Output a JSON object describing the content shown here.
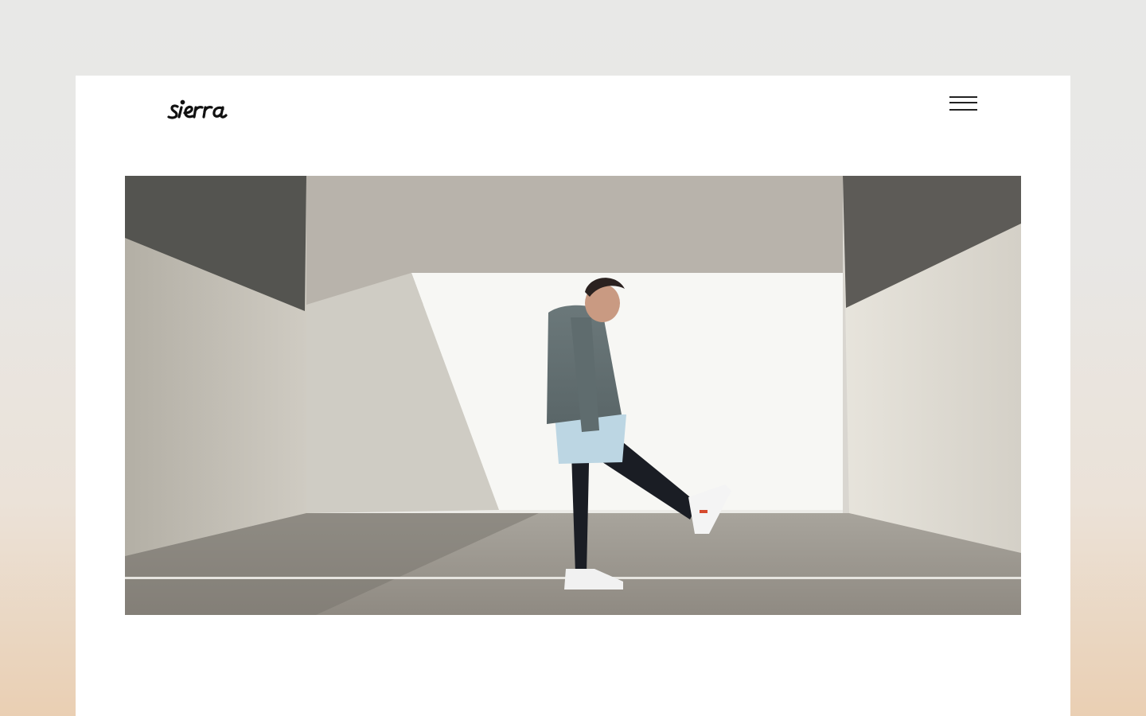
{
  "site": {
    "logo_text": "sierra",
    "menu_icon": "hamburger-menu-icon"
  },
  "hero": {
    "image_subject": "hero-photo"
  },
  "colors": {
    "page_background_top": "#e8e8e7",
    "page_background_bottom": "#eacfb3",
    "frame_background": "#ffffff",
    "ink": "#111111"
  }
}
